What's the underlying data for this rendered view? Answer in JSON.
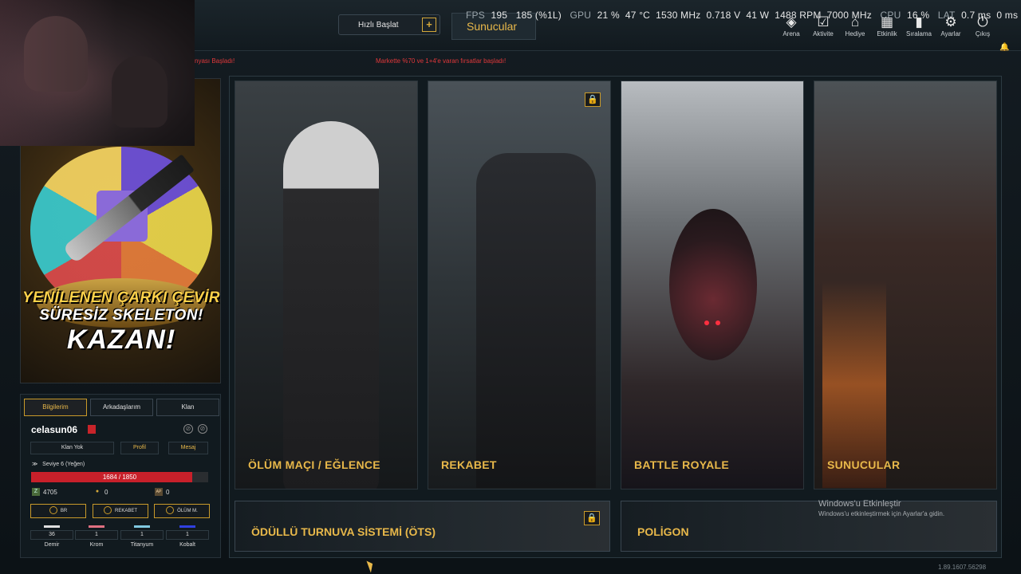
{
  "topbar": {
    "quick_start_label": "Hızlı Başlat",
    "quick_start_plus": "+",
    "servers_tab": "Sunucular"
  },
  "osd": {
    "fps_label": "FPS",
    "fps": "195",
    "fps_low": "185 (%1L)",
    "gpu_label": "GPU",
    "gpu_load": "21 %",
    "gpu_temp": "47 °C",
    "gpu_clock": "1530 MHz",
    "gpu_voltage": "0.718 V",
    "gpu_power": "41 W",
    "fan": "1488 RPM",
    "mem_clock": "7000 MHz",
    "cpu_label": "CPU",
    "cpu_load": "16 %",
    "lat_label": "LAT",
    "lat1": "0.7 ms",
    "lat2": "0 ms"
  },
  "topnav": [
    {
      "label": "Arena",
      "icon": "arena-icon",
      "glyph": "◈"
    },
    {
      "label": "Aktivite",
      "icon": "activity-icon",
      "glyph": "☑"
    },
    {
      "label": "Hediye",
      "icon": "gift-icon",
      "glyph": "⌂"
    },
    {
      "label": "Etkinlik",
      "icon": "calendar-icon",
      "glyph": "▦"
    },
    {
      "label": "Sıralama",
      "icon": "ranking-icon",
      "glyph": "▮"
    },
    {
      "label": "Ayarlar",
      "icon": "gear-icon",
      "glyph": "⚙"
    },
    {
      "label": "Çıkış",
      "icon": "power-icon",
      "glyph": "⏻"
    }
  ],
  "ticker": {
    "left": "nyası Başladı!",
    "center": "Markette %70 ve 1+4'e varan fırsatlar başladı!"
  },
  "promo": {
    "line1": "YENİLENEN ÇARKI ÇEVİR",
    "line2": "SÜRESİZ SKELETON!",
    "line3": "KAZAN!"
  },
  "profile": {
    "tabs": [
      "Bilgilerim",
      "Arkadaşlarım",
      "Klan"
    ],
    "username": "celasun06",
    "clan": "Klan Yok",
    "profile_btn": "Profil",
    "message_btn": "Mesaj",
    "level": "Seviye 6 (Yeğen)",
    "xp_text": "1684 / 1850",
    "xp_fraction": 0.91,
    "currency": [
      {
        "icon": "z-coin-icon",
        "glyph": "Z",
        "value": "4705",
        "color": "#7a9a5a"
      },
      {
        "icon": "gold-coin-icon",
        "glyph": "●",
        "value": "0",
        "color": "#d4a83a"
      },
      {
        "icon": "ap-icon",
        "glyph": "AP",
        "value": "0",
        "color": "#c89a5a"
      }
    ],
    "modes": [
      "BR",
      "REKABET",
      "ÖLÜM M."
    ],
    "metals": [
      {
        "name": "Demir",
        "value": "36",
        "color": "#e0e0e0"
      },
      {
        "name": "Krom",
        "value": "1",
        "color": "#e07080"
      },
      {
        "name": "Titanyum",
        "value": "1",
        "color": "#80c8e0"
      },
      {
        "name": "Kobalt",
        "value": "1",
        "color": "#3040e0"
      }
    ]
  },
  "modes": {
    "deathmatch": "ÖLÜM MAÇI / EĞLENCE",
    "competitive": "REKABET",
    "battle_royale": "BATTLE ROYALE",
    "servers": "SUNUCULAR",
    "tournament": "ÖDÜLLÜ TURNUVA SİSTEMİ (ÖTS)",
    "polygon": "POLİGON"
  },
  "watermark": {
    "line1": "Windows'u Etkinleştir",
    "line2": "Windows'u etkinleştirmek için Ayarlar'a gidin."
  },
  "version": "1.89.1607.56298"
}
